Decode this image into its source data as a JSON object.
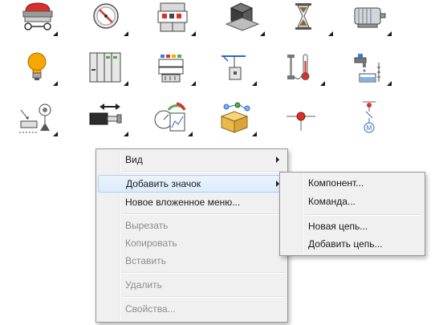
{
  "icons": [
    {
      "name": "emergency-button-icon"
    },
    {
      "name": "gauge-dial-icon"
    },
    {
      "name": "relay-module-icon"
    },
    {
      "name": "weight-block-icon"
    },
    {
      "name": "hourglass-icon"
    },
    {
      "name": "electric-motor-icon"
    },
    {
      "name": "light-bulb-icon"
    },
    {
      "name": "control-cabinet-icon"
    },
    {
      "name": "terminal-block-icon"
    },
    {
      "name": "crane-hoist-icon"
    },
    {
      "name": "thermometer-icon"
    },
    {
      "name": "water-tap-icon"
    },
    {
      "name": "antenna-sensor-icon"
    },
    {
      "name": "linear-actuator-icon"
    },
    {
      "name": "meter-chart-icon"
    },
    {
      "name": "network-box-icon"
    },
    {
      "name": "connection-point-icon"
    },
    {
      "name": "motor-node-icon"
    }
  ],
  "context_menu": {
    "items": [
      {
        "label": "Вид",
        "has_submenu": true
      },
      {
        "label": "Добавить значок",
        "has_submenu": true
      },
      {
        "label": "Новое вложенное меню..."
      },
      {
        "label": "Вырезать",
        "disabled": true
      },
      {
        "label": "Копировать",
        "disabled": true
      },
      {
        "label": "Вставить",
        "disabled": true
      },
      {
        "label": "Удалить",
        "disabled": true
      },
      {
        "label": "Свойства...",
        "disabled": true
      }
    ]
  },
  "submenu": {
    "items": [
      {
        "label": "Компонент..."
      },
      {
        "label": "Команда..."
      },
      {
        "label": "Новая цепь..."
      },
      {
        "label": "Добавить цепь..."
      }
    ]
  },
  "colors": {
    "accent_red": "#d9302a",
    "accent_yellow": "#f5a800",
    "menu_background": "#f0f0f0",
    "menu_highlight": "#dcebfb"
  }
}
